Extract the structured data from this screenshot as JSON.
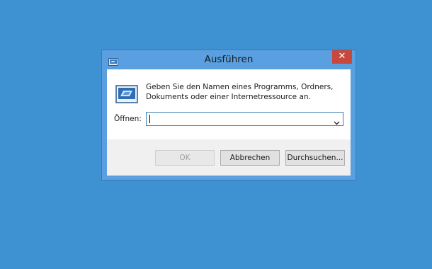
{
  "window": {
    "title": "Ausführen",
    "close_glyph": "✕",
    "icon": "run-icon"
  },
  "content": {
    "description": "Geben Sie den Namen eines Programms, Ordners, Dokuments oder einer Internetressource an.",
    "open_label": "Öffnen:",
    "open_value": "",
    "big_icon": "run-icon"
  },
  "buttons": {
    "ok": "OK",
    "cancel": "Abbrechen",
    "browse": "Durchsuchen..."
  },
  "colors": {
    "desktop": "#3f92d2",
    "frame": "#5aa0e0",
    "close": "#c7483d"
  }
}
